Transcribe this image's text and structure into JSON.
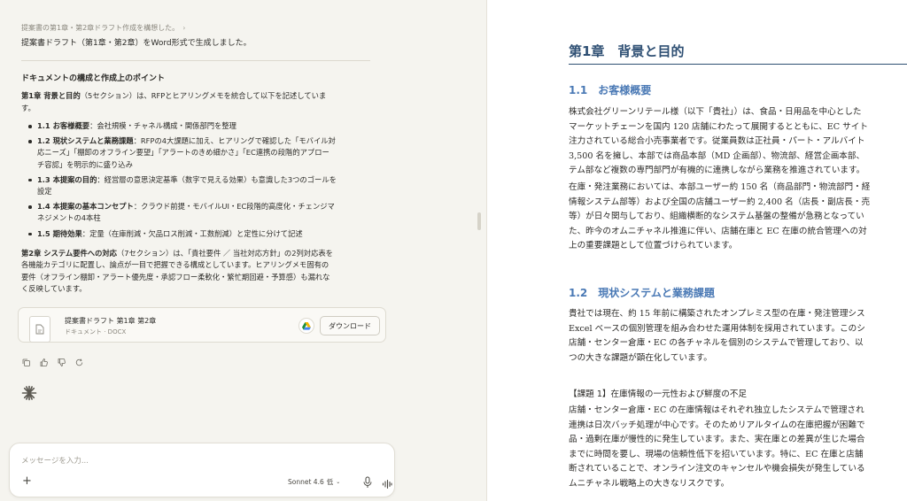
{
  "chat": {
    "breadcrumb": "提案書の第1章・第2章ドラフト作成を構想した。",
    "intro": "提案書ドラフト（第1章・第2章）をWord形式で生成しました。",
    "section_title": "ドキュメントの構成と作成上のポイント",
    "ch1_para_bold": "第1章 背景と目的",
    "ch1_para_rest": "（5セクション）は、RFPとヒアリングメモを統合して以下を記述していま",
    "ch1_para_wrap": "す。",
    "bullets": [
      {
        "bold": "1.1 お客様概要",
        "lines": [
          "：会社規模・チャネル構成・関係部門を整理"
        ]
      },
      {
        "bold": "1.2 現状システムと業務課題",
        "lines": [
          "：RFPの4大課題に加え、ヒアリングで確認した「モバイル対",
          "応ニーズ」「棚卸のオフライン要望」「アラートのきめ細かさ」「EC連携の段階的アプロー",
          "チ容認」を明示的に盛り込み"
        ]
      },
      {
        "bold": "1.3 本提案の目的",
        "lines": [
          "：経営層の意思決定基準（数字で見える効果）も意識した3つのゴールを",
          "設定"
        ]
      },
      {
        "bold": "1.4 本提案の基本コンセプト",
        "lines": [
          "：クラウド前提・モバイルUI・EC段階的高度化・チェンジマ",
          "ネジメントの4本柱"
        ]
      },
      {
        "bold": "1.5 期待効果",
        "lines": [
          "：定量（在庫削減・欠品ロス削減・工数削減）と定性に分けて記述"
        ]
      }
    ],
    "ch2_para_bold": "第2章 システム要件への対応",
    "ch2_lines": [
      "（7セクション）は、「貴社要件 ／ 当社対応方針」の2列対応表を",
      "各機能カテゴリに配置し、論点が一目で把握できる構成としています。ヒアリングメモ固有の",
      "要件（オフライン棚卸・アラート優先度・承認フロー柔軟化・繁忙期回避・予算感）も漏れな",
      "く反映しています。"
    ],
    "file": {
      "name": "提案書ドラフト 第1章 第2章",
      "meta": "ドキュメント · DOCX",
      "download": "ダウンロード"
    },
    "composer": {
      "placeholder": "メッセージを入力...",
      "plus": "+",
      "model": "Sonnet 4.6",
      "effort": "低"
    }
  },
  "doc": {
    "chapter_title": "第1章　背景と目的",
    "s11_title": "1.1　お客様概要",
    "s11_p1": [
      "株式会社グリーンリテール様（以下「貴社」）は、食品・日用品を中心とした",
      "マーケットチェーンを国内 120 店舗にわたって展開するとともに、EC サイト",
      "注力されている総合小売事業者です。従業員数は正社員・パート・アルバイト",
      "3,500 名を擁し、本部では商品本部（MD 企画部）、物流部、経営企画本部、",
      "テム部など複数の専門部門が有機的に連携しながら業務を推進されています。"
    ],
    "s11_p2": [
      "在庫・発注業務においては、本部ユーザー約 150 名（商品部門・物流部門・経",
      "情報システム部等）および全国の店舗ユーザー約 2,400 名（店長・副店長・売",
      "等）が日々関与しており、組織横断的なシステム基盤の整備が急務となってい",
      "た、昨今のオムニチャネル推進に伴い、店舗在庫と EC 在庫の統合管理への対",
      "上の重要課題として位置づけられています。"
    ],
    "s12_title": "1.2　現状システムと業務課題",
    "s12_p1": [
      "貴社では現在、約 15 年前に構築されたオンプレミス型の在庫・発注管理シス",
      "Excel ベースの個別管理を組み合わせた運用体制を採用されています。このシ",
      "店舗・センター倉庫・EC の各チャネルを個別のシステムで管理しており、以",
      "つの大きな課題が顕在化しています。"
    ],
    "issue1": "【課題 1】在庫情報の一元性および鮮度の不足",
    "issue1_p": [
      "店舗・センター倉庫・EC の在庫情報はそれぞれ独立したシステムで管理され",
      "連携は日次バッチ処理が中心です。そのためリアルタイムの在庫把握が困難で",
      "品・過剰在庫が慢性的に発生しています。また、実在庫との差異が生じた場合",
      "までに時間を要し、現場の信頼性低下を招いています。特に、EC 在庫と店舗",
      "断されていることで、オンライン注文のキャンセルや機会損失が発生している",
      "ムニチャネル戦略上の大きなリスクです。"
    ]
  }
}
